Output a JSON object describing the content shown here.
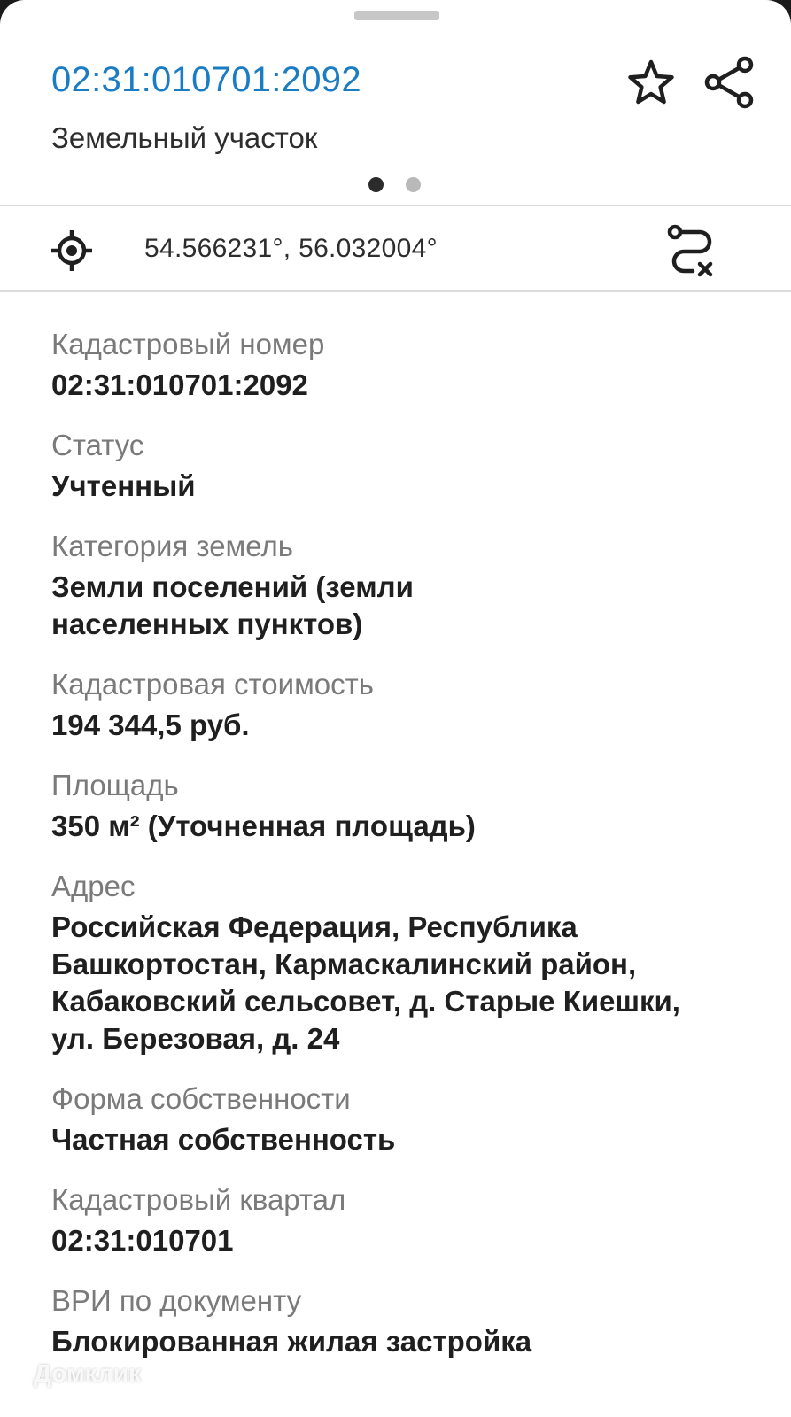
{
  "header": {
    "cadastral_number": "02:31:010701:2092",
    "object_type": "Земельный участок",
    "star_icon": "star-outline-icon",
    "share_icon": "share-icon",
    "pager": {
      "total": 2,
      "active": 1
    }
  },
  "coords": {
    "icon": "locate-target-icon",
    "text": "54.566231°, 56.032004°",
    "route_icon": "route-clear-icon"
  },
  "fields": [
    {
      "label": "Кадастровый номер",
      "value": "02:31:010701:2092"
    },
    {
      "label": "Статус",
      "value": "Учтенный"
    },
    {
      "label": "Категория земель",
      "value": "Земли поселений (земли\nнаселенных пунктов)"
    },
    {
      "label": "Кадастровая стоимость",
      "value": "194 344,5 руб."
    },
    {
      "label": "Площадь",
      "value": "350 м² (Уточненная площадь)"
    },
    {
      "label": "Адрес",
      "value": "Российская Федерация, Республика\nБашкортостан, Кармаскалинский район,\nКабаковский сельсовет, д. Старые Киешки,\nул. Березовая, д. 24"
    },
    {
      "label": "Форма собственности",
      "value": "Частная собственность"
    },
    {
      "label": "Кадастровый квартал",
      "value": "02:31:010701"
    },
    {
      "label": "ВРИ по документу",
      "value": "Блокированная жилая застройка"
    }
  ],
  "watermark": "Домклик",
  "colors": {
    "link": "#1a7cc4",
    "label": "#7a7a7a",
    "value": "#1f1f1f"
  }
}
